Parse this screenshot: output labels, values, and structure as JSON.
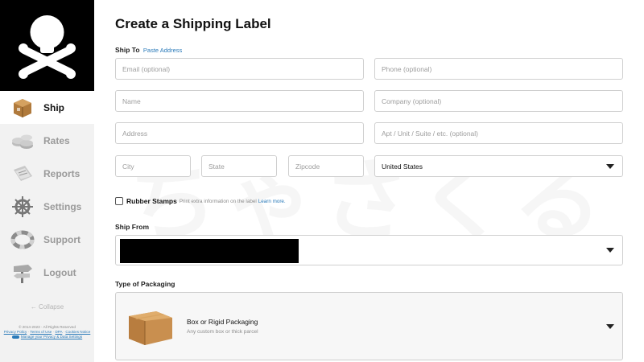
{
  "sidebar": {
    "logo": "skull-crossbones-logo",
    "items": [
      {
        "label": "Ship",
        "icon": "shipping-box-icon",
        "active": true
      },
      {
        "label": "Rates",
        "icon": "coin-stack-icon",
        "active": false
      },
      {
        "label": "Reports",
        "icon": "reports-icon",
        "active": false
      },
      {
        "label": "Settings",
        "icon": "ship-wheel-icon",
        "active": false
      },
      {
        "label": "Support",
        "icon": "life-ring-icon",
        "active": false
      },
      {
        "label": "Logout",
        "icon": "signpost-icon",
        "active": false
      }
    ],
    "collapse": "← Collapse",
    "footer": {
      "copyright": "© 2014-2023 · All Rights Reserved",
      "privacy": "Privacy Policy",
      "terms": "Terms of Use",
      "dpa": "DPA",
      "cookies": "Cookies Notice",
      "manage": "Manage your Privacy & Data Settings"
    }
  },
  "main": {
    "title": "Create a Shipping Label",
    "ship_to": {
      "label": "Ship To",
      "paste_link": "Paste Address",
      "email_placeholder": "Email (optional)",
      "phone_placeholder": "Phone (optional)",
      "name_placeholder": "Name",
      "company_placeholder": "Company (optional)",
      "address_placeholder": "Address",
      "apt_placeholder": "Apt / Unit / Suite / etc. (optional)",
      "city_placeholder": "City",
      "state_placeholder": "State",
      "zip_placeholder": "Zipcode",
      "country": "United States"
    },
    "rubber_stamps": {
      "label": "Rubber Stamps",
      "help": "Print extra information on the label",
      "link": "Learn more."
    },
    "ship_from": {
      "label": "Ship From"
    },
    "packaging": {
      "label": "Type of Packaging",
      "title": "Box or Rigid Packaging",
      "subtitle": "Any custom box or thick parcel"
    }
  },
  "colors": {
    "link": "#2a7ab9",
    "sidebar_bg": "#f2f2f2",
    "logo_bg": "#000000"
  }
}
